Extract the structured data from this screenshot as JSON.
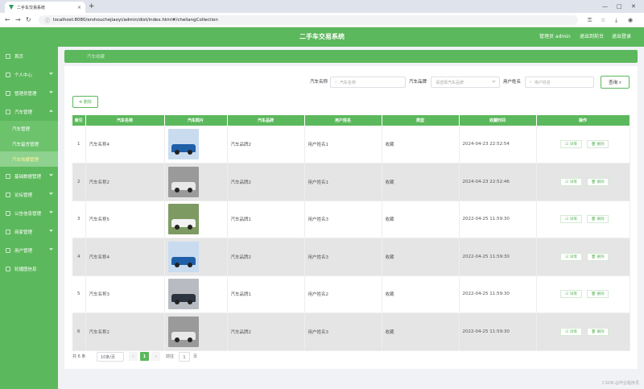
{
  "browser": {
    "tab_title": "二手车交易系统",
    "tab_close": "×",
    "new_tab": "+",
    "url": "localhost:8080/ershouchejiaoyi/admin/dist/index.html#/cheliangCollection",
    "win_min": "—",
    "win_max": "□",
    "win_close": "✕"
  },
  "header": {
    "title": "二手车交易系统",
    "user": "管理员 admin",
    "exit_backend": "退出到前台",
    "logout": "退出登录"
  },
  "sidebar": {
    "items": [
      {
        "label": "首页",
        "chevron": false
      },
      {
        "label": "个人中心",
        "chevron": true
      },
      {
        "label": "管理员管理",
        "chevron": true
      },
      {
        "label": "汽车管理",
        "chevron": true
      }
    ],
    "sub_items": [
      {
        "label": "汽车管理",
        "active": false
      },
      {
        "label": "汽车留言管理",
        "active": false
      },
      {
        "label": "汽车收藏管理",
        "active": true
      }
    ],
    "items_after": [
      {
        "label": "基础数据管理"
      },
      {
        "label": "论坛管理"
      },
      {
        "label": "公告信息管理"
      },
      {
        "label": "商家管理"
      },
      {
        "label": "用户管理"
      },
      {
        "label": "轮播图信息"
      }
    ]
  },
  "breadcrumb": "汽车收藏",
  "search": {
    "name_label": "汽车名称",
    "name_placeholder": "汽车名称",
    "brand_label": "汽车品牌",
    "brand_placeholder": "请选择汽车品牌",
    "user_label": "用户姓名",
    "user_placeholder": "用户姓名",
    "button": "查询 ⌕"
  },
  "delete_button": "⊗ 删除",
  "table": {
    "headers": [
      "索引",
      "汽车名称",
      "汽车照片",
      "汽车品牌",
      "用户姓名",
      "类型",
      "收藏时间",
      "操作"
    ],
    "detail_label": "☑ 详情",
    "delete_label": "🗑 删除",
    "rows": [
      {
        "idx": "1",
        "name": "汽车名称4",
        "brand": "汽车品牌2",
        "user": "用户姓名1",
        "type": "收藏",
        "time": "2024-04-23 22:52:54",
        "car_color": "#1f5fa8",
        "bg": "#c9dcef"
      },
      {
        "idx": "2",
        "name": "汽车名称2",
        "brand": "汽车品牌2",
        "user": "用户姓名1",
        "type": "收藏",
        "time": "2024-04-23 22:52:46",
        "car_color": "#e8e8e8",
        "bg": "#9a9a9a"
      },
      {
        "idx": "3",
        "name": "汽车名称5",
        "brand": "汽车品牌1",
        "user": "用户姓名3",
        "type": "收藏",
        "time": "2022-04-25 11:59:30",
        "car_color": "#f2f2f2",
        "bg": "#7d9a63"
      },
      {
        "idx": "4",
        "name": "汽车名称4",
        "brand": "汽车品牌2",
        "user": "用户姓名3",
        "type": "收藏",
        "time": "2022-04-25 11:59:30",
        "car_color": "#1f5fa8",
        "bg": "#c9dcef"
      },
      {
        "idx": "5",
        "name": "汽车名称3",
        "brand": "汽车品牌1",
        "user": "用户姓名2",
        "type": "收藏",
        "time": "2022-04-25 11:59:30",
        "car_color": "#2c3440",
        "bg": "#b8bcc2"
      },
      {
        "idx": "6",
        "name": "汽车名称2",
        "brand": "汽车品牌2",
        "user": "用户姓名3",
        "type": "收藏",
        "time": "2022-04-25 11:59:30",
        "car_color": "#e8e8e8",
        "bg": "#9a9a9a"
      }
    ]
  },
  "pagination": {
    "total": "共 6 条",
    "page_size": "10条/页",
    "prev": "‹",
    "current": "1",
    "next": "›",
    "goto_label": "前往",
    "goto_value": "1",
    "page_unit": "页"
  },
  "watermark": "CSDN @毕业程序员"
}
